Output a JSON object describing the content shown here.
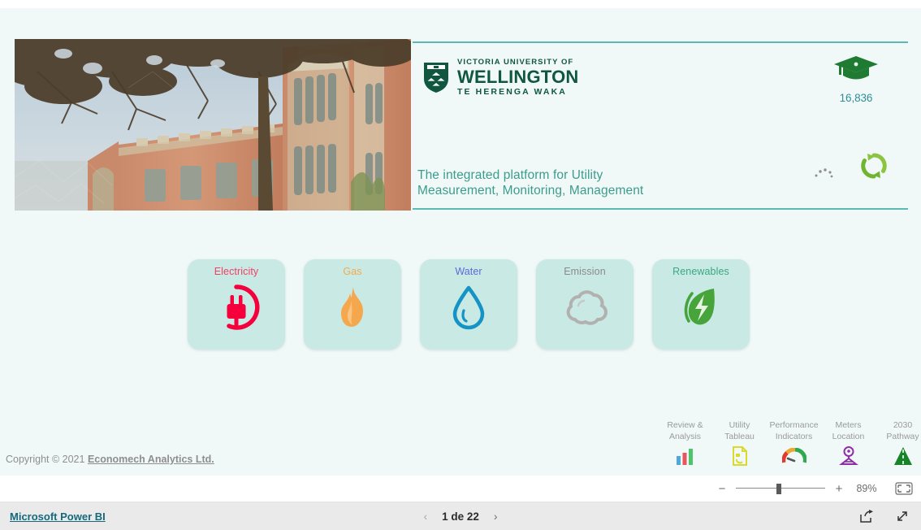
{
  "report": {
    "hero_image_alt": "hunter-building-painting",
    "header": {
      "logo": {
        "line1": "VICTORIA UNIVERSITY OF",
        "line2": "WELLINGTON",
        "line3": "TE HERENGA WAKA",
        "icon": "shield-crest-icon",
        "color": "#115740"
      },
      "kpi_students": {
        "icon": "graduation-cap-icon",
        "value": "16,836",
        "color": "#2f8f96",
        "icon_color": "#1f7a32"
      },
      "refresh": {
        "icon": "refresh-circular-arrows-icon",
        "spinner_icon": "loading-dots-icon",
        "color": "#78c043"
      },
      "tagline_line1": "The integrated platform for Utility",
      "tagline_line2": "Measurement, Monitoring, Management",
      "tagline_color": "#3c9c8d",
      "rule_color": "#5bb8b5"
    },
    "tiles": [
      {
        "label": "Electricity",
        "icon": "power-plug-icon",
        "label_color": "#f43e63",
        "icon_color": "#f5003c"
      },
      {
        "label": "Gas",
        "icon": "flame-icon",
        "label_color": "#f7a94a",
        "icon_color": "#f5a74e"
      },
      {
        "label": "Water",
        "icon": "water-drop-icon",
        "label_color": "#5b6bd8",
        "icon_color": "#1593c4"
      },
      {
        "label": "Emission",
        "icon": "cloud-icon",
        "label_color": "#8b8b8b",
        "icon_color": "#b3b0b0"
      },
      {
        "label": "Renewables",
        "icon": "leaf-bolt-icon",
        "label_color": "#3aa87f",
        "icon_color": "#46a43a"
      }
    ],
    "tile_background": "#c8e9e4",
    "bottom_nav": [
      {
        "label": "Review &\nAnalysis",
        "icon": "bar-chart-icon"
      },
      {
        "label": "Utility\nTableau",
        "icon": "document-report-icon"
      },
      {
        "label": "Performance\nIndicators",
        "icon": "gauge-icon"
      },
      {
        "label": "Meters\nLocation",
        "icon": "map-pin-icon"
      },
      {
        "label": "2030\nPathway",
        "icon": "road-icon"
      }
    ],
    "copyright": {
      "prefix": "Copyright © 2021 ",
      "link": "Economech Analytics Ltd."
    }
  },
  "zoom_bar": {
    "minus": "−",
    "plus": "+",
    "percent": "89%",
    "fit_icon": "fit-to-page-icon"
  },
  "footer": {
    "brand": "Microsoft Power BI",
    "brand_color": "#16697d",
    "prev_icon": "chevron-left-icon",
    "next_icon": "chevron-right-icon",
    "page_label": "1 de 22",
    "share_icon": "share-icon",
    "fullscreen_icon": "fullscreen-icon"
  }
}
